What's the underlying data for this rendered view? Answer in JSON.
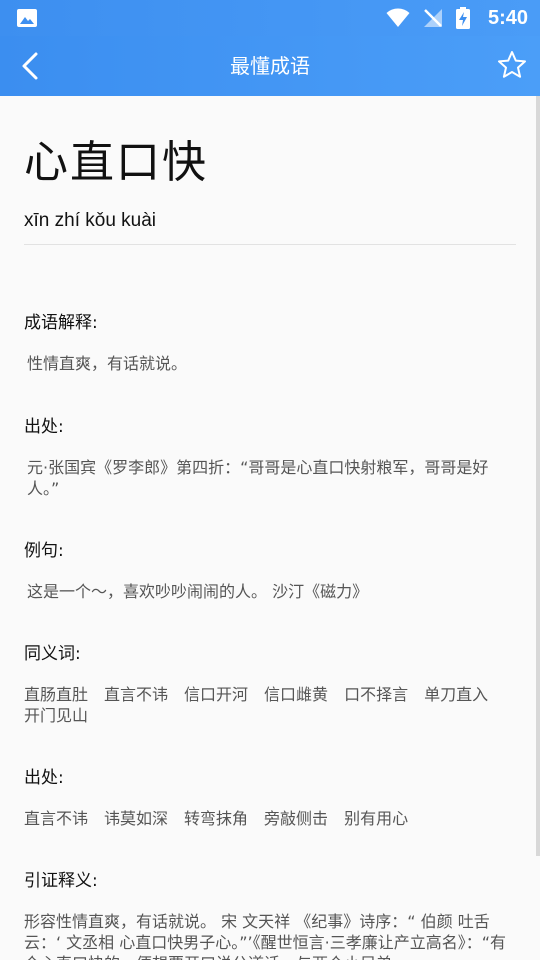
{
  "status_bar": {
    "time": "5:40"
  },
  "app_bar": {
    "title": "最懂成语"
  },
  "idiom": {
    "title": "心直口快",
    "pinyin": "xīn zhí kǒu kuài"
  },
  "sections": {
    "meaning": {
      "heading": "成语解释:",
      "text": "性情直爽，有话就说。"
    },
    "source": {
      "heading": "出处:",
      "text": "元·张国宾《罗李郎》第四折：“哥哥是心直口快射粮军，哥哥是好人。”"
    },
    "example": {
      "heading": "例句:",
      "text": "这是一个～，喜欢吵吵闹闹的人。 沙汀《磁力》"
    },
    "synonyms": {
      "heading": "同义词:",
      "items": [
        "直肠直肚",
        "直言不讳",
        "信口开河",
        "信口雌黄",
        "口不择言",
        "单刀直入",
        "开门见山"
      ]
    },
    "related": {
      "heading": "出处:",
      "items": [
        "直言不讳",
        "讳莫如深",
        "转弯抹角",
        "旁敲侧击",
        "别有用心"
      ]
    },
    "citation": {
      "heading": "引证释义:",
      "text": "形容性情直爽，有话就说。 宋 文天祥 《纪事》诗序：“ 伯颜 吐舌云：‘ 文丞相 心直口快男子心。”’《醒世恒言·三孝廉让产立高名》：“有个心直口快的，便想要开口说公道话，与两个小兄弟"
    }
  },
  "colors": {
    "app_bar": "#4294f4",
    "background": "#fafafa"
  }
}
